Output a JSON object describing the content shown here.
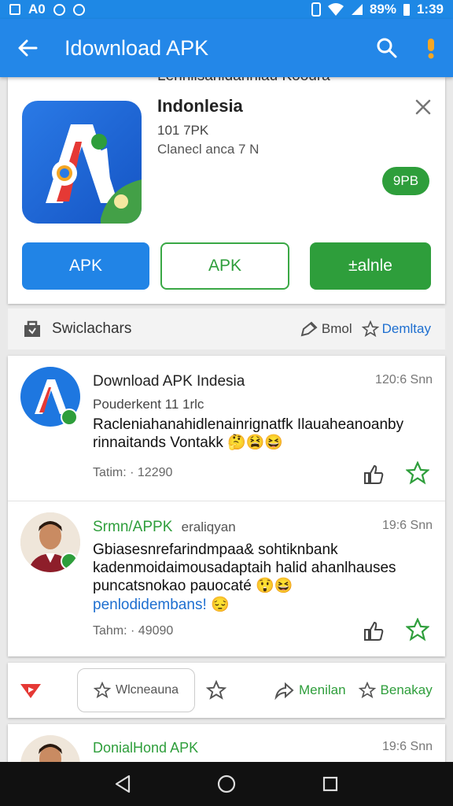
{
  "status_bar": {
    "left_text": "A0",
    "battery": "89%",
    "time": "1:39"
  },
  "appbar": {
    "title": "Idownload APK"
  },
  "app_card": {
    "header_peek": "Lennlisanidanniau Kooura",
    "name": "Indonlesia",
    "size": "101 7PK",
    "developer": "Clanecl anca 7 N",
    "badge": "9PB",
    "btn_primary": "APK",
    "btn_outline": "APK",
    "btn_install": "±alnle"
  },
  "filter_bar": {
    "label": "Swiclachars",
    "item1": "Bmol",
    "item2": "Demltay"
  },
  "posts": [
    {
      "user": "Download APK Indesia",
      "time": "120:6 Snn",
      "sub": "Pouderkent 11 1rlc",
      "body": "Racleniahanahidlenainrignatfk Ilauaheanoanby rinnaitands Vontakk 🤔😫😆",
      "meta": "Tatim: · 12290"
    },
    {
      "user": "Srmn/APPK",
      "user_tag": "eraliqyan",
      "time": "19:6 Snn",
      "body": "Gbiasesnrefarindmpaa& sohtiknbank kadenmoidaimousadaptaih halid ahanlhauses puncatsnokao pauocaté 😲😆",
      "body_link": "penlodidembans! 😔",
      "meta": "Tahm: · 49090"
    }
  ],
  "bottom_bar": {
    "chip": "Wlcneauna",
    "action1": "Menilan",
    "action2": "Benakay"
  },
  "peek_post": {
    "user": "DonialHond APK",
    "time": "19:6 Snn"
  },
  "colors": {
    "primary": "#2387e8",
    "green": "#2e9e3b",
    "badge_orange": "#f5a623"
  }
}
